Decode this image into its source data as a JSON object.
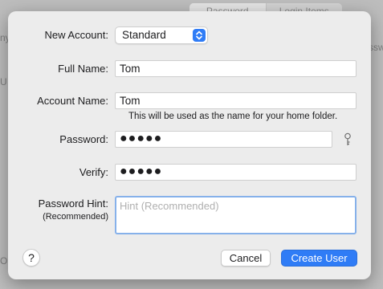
{
  "background": {
    "tabs": [
      "Password",
      "Login Items"
    ],
    "fragments": [
      "ny",
      "U",
      "ssw",
      "Op"
    ]
  },
  "form": {
    "new_account": {
      "label": "New Account:",
      "value": "Standard"
    },
    "full_name": {
      "label": "Full Name:",
      "value": "Tom"
    },
    "account_name": {
      "label": "Account Name:",
      "value": "Tom",
      "note": "This will be used as the name for your home folder."
    },
    "password": {
      "label": "Password:",
      "value": "●●●●●"
    },
    "verify": {
      "label": "Verify:",
      "value": "●●●●●"
    },
    "hint": {
      "label": "Password Hint:",
      "sublabel": "(Recommended)",
      "placeholder": "Hint (Recommended)"
    }
  },
  "buttons": {
    "help": "?",
    "cancel": "Cancel",
    "create": "Create User"
  },
  "colors": {
    "accent": "#2f7cf6",
    "focus_ring": "#86b1ea",
    "sheet_bg": "#ececec"
  },
  "icons": {
    "password_assistant": "key-icon",
    "popup": "up-down-arrows-icon"
  }
}
